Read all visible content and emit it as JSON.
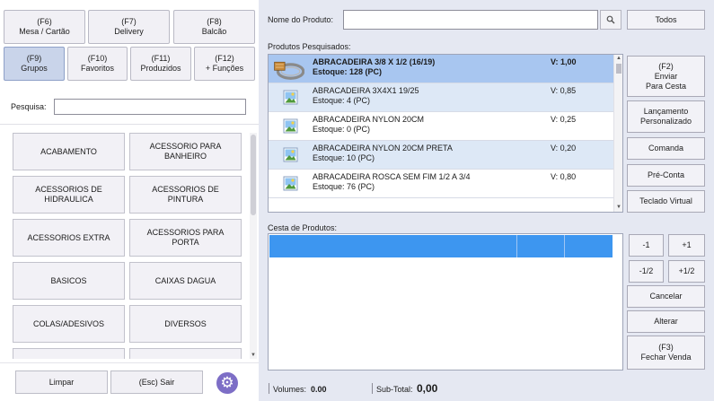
{
  "function_buttons": [
    {
      "key": "(F6)",
      "label": "Mesa / Cartão"
    },
    {
      "key": "(F7)",
      "label": "Delivery"
    },
    {
      "key": "(F8)",
      "label": "Balcão"
    },
    {
      "key": "(F9)",
      "label": "Grupos"
    },
    {
      "key": "(F10)",
      "label": "Favoritos"
    },
    {
      "key": "(F11)",
      "label": "Produzidos"
    },
    {
      "key": "(F12)",
      "label": "+ Funções"
    }
  ],
  "group_search": {
    "label": "Pesquisa:",
    "value": ""
  },
  "categories": [
    "ACABAMENTO",
    "ACESSORIO PARA BANHEIRO",
    "ACESSORIOS DE HIDRAULICA",
    "ACESSORIOS DE PINTURA",
    "ACESSORIOS EXTRA",
    "ACESSORIOS PARA PORTA",
    "BASICOS",
    "CAIXAS DAGUA",
    "COLAS/ADESIVOS",
    "DIVERSOS",
    "",
    ""
  ],
  "bottom": {
    "clear_label": "Limpar",
    "exit_label": "(Esc) Sair",
    "settings_icon": "gear-icon"
  },
  "product_search": {
    "label": "Nome do Produto:",
    "value": "",
    "search_icon": "magnifier-icon",
    "all_label": "Todos"
  },
  "products_section_label": "Produtos Pesquisados:",
  "products": [
    {
      "name": "ABRACADEIRA 3/8 X 1/2 (16/19)",
      "stock": "Estoque: 128 (PC)",
      "value": "V: 1,00",
      "image": "hose-clamp-photo"
    },
    {
      "name": "ABRACADEIRA 3X4X1 19/25",
      "stock": "Estoque: 4 (PC)",
      "value": "V: 0,85",
      "image": "image-placeholder-icon"
    },
    {
      "name": "ABRACADEIRA NYLON 20CM",
      "stock": "Estoque: 0 (PC)",
      "value": "V: 0,25",
      "image": "image-placeholder-icon"
    },
    {
      "name": "ABRACADEIRA NYLON 20CM PRETA",
      "stock": "Estoque: 10 (PC)",
      "value": "V: 0,20",
      "image": "image-placeholder-icon"
    },
    {
      "name": "ABRACADEIRA ROSCA SEM FIM 1/2 A 3/4",
      "stock": "Estoque: 76 (PC)",
      "value": "V: 0,80",
      "image": "image-placeholder-icon"
    }
  ],
  "side_actions": [
    {
      "line1": "(F2)",
      "line2": "Enviar",
      "line3": "Para Cesta"
    },
    {
      "line1": "Lançamento",
      "line2": "Personalizado",
      "line3": ""
    },
    {
      "line1": "Comanda",
      "line2": "",
      "line3": ""
    },
    {
      "line1": "Pré-Conta",
      "line2": "",
      "line3": ""
    },
    {
      "line1": "Teclado Virtual",
      "line2": "",
      "line3": ""
    }
  ],
  "basket_label": "Cesta de Produtos:",
  "qty_buttons": [
    "-1",
    "+1",
    "-1/2",
    "+1/2"
  ],
  "basket_actions": {
    "cancel": "Cancelar",
    "change": "Alterar",
    "finish_key": "(F3)",
    "finish_label": "Fechar Venda"
  },
  "status": {
    "volumes_label": "Volumes:",
    "volumes_value": "0.00",
    "subtotal_label": "Sub-Total:",
    "subtotal_value": "0,00"
  },
  "colors": {
    "basket_header": "#3d96f0",
    "selected_row": "#a8c6f0",
    "alt_row": "#dde8f6",
    "panel_bg": "#e5e8f2",
    "settings_icon": "#7d6ec6"
  }
}
